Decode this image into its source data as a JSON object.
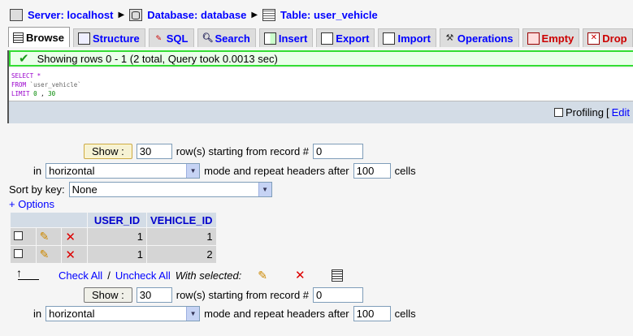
{
  "breadcrumb": {
    "server": "Server: localhost",
    "database": "Database: database",
    "table": "Table: user_vehicle"
  },
  "tabs": [
    {
      "label": "Browse",
      "icon": "browse-icon"
    },
    {
      "label": "Structure",
      "icon": "structure-icon"
    },
    {
      "label": "SQL",
      "icon": "sql-icon"
    },
    {
      "label": "Search",
      "icon": "search-icon"
    },
    {
      "label": "Insert",
      "icon": "insert-icon"
    },
    {
      "label": "Export",
      "icon": "export-icon"
    },
    {
      "label": "Import",
      "icon": "import-icon"
    },
    {
      "label": "Operations",
      "icon": "operations-icon"
    },
    {
      "label": "Empty",
      "icon": "empty-icon"
    },
    {
      "label": "Drop",
      "icon": "drop-icon"
    }
  ],
  "notice": "Showing rows 0 - 1 (2 total, Query took 0.0013 sec)",
  "sql": {
    "line1_kw": "SELECT",
    "line1_rest": " *",
    "line2_kw": "FROM",
    "line2_tbl": "`user_vehicle`",
    "line3_kw": "LIMIT",
    "line3_a": "0",
    "line3_sep": " , ",
    "line3_b": "30"
  },
  "profiling": {
    "label": "Profiling",
    "bracket": "[",
    "edit": "Edit"
  },
  "nav": {
    "show_label": "Show :",
    "rows_value": "30",
    "rows_text": "row(s) starting from record #",
    "start_value": "0",
    "in_text": "in",
    "mode_value": "horizontal",
    "mode_text": "mode and repeat headers after",
    "headers_value": "100",
    "cells_text": "cells"
  },
  "sort": {
    "label": "Sort by key:",
    "value": "None"
  },
  "options_link": "+ Options",
  "table": {
    "columns": [
      "USER_ID",
      "VEHICLE_ID"
    ],
    "rows": [
      {
        "user_id": "1",
        "vehicle_id": "1"
      },
      {
        "user_id": "1",
        "vehicle_id": "2"
      }
    ]
  },
  "bulk": {
    "check_all": "Check All",
    "slash": " / ",
    "uncheck_all": "Uncheck All",
    "with_selected": "With selected:"
  },
  "colors": {
    "tab_link": "#0000ff",
    "header_bg": "#d3dce6",
    "notice_border": "#33dd33",
    "danger": "#cc0000"
  }
}
